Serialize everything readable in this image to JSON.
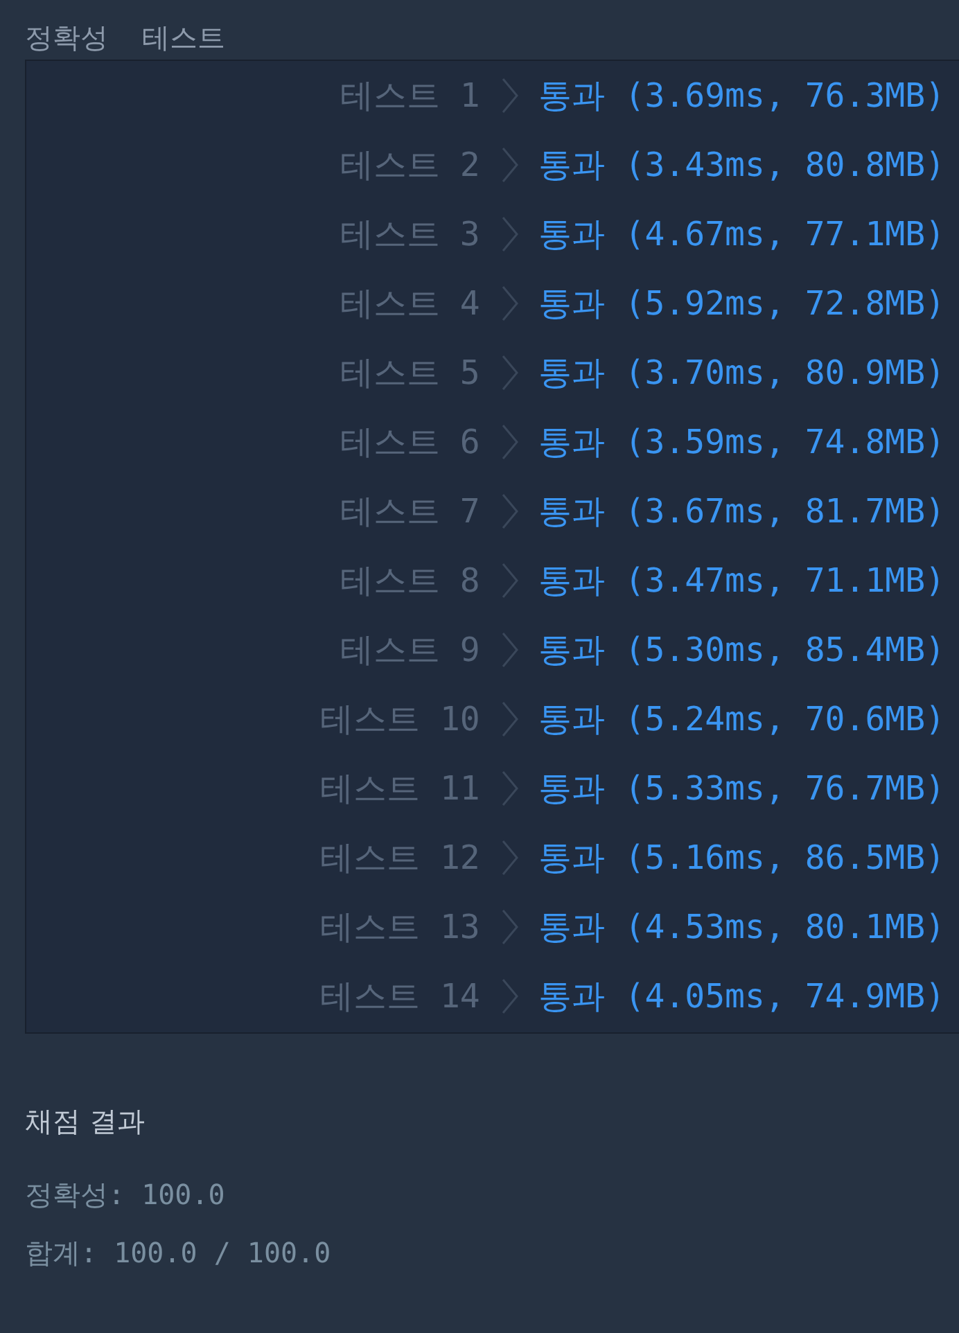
{
  "section_title": "정확성 테스트",
  "tests": [
    {
      "label": "테스트 1",
      "result": "통과 (3.69ms, 76.3MB)"
    },
    {
      "label": "테스트 2",
      "result": "통과 (3.43ms, 80.8MB)"
    },
    {
      "label": "테스트 3",
      "result": "통과 (4.67ms, 77.1MB)"
    },
    {
      "label": "테스트 4",
      "result": "통과 (5.92ms, 72.8MB)"
    },
    {
      "label": "테스트 5",
      "result": "통과 (3.70ms, 80.9MB)"
    },
    {
      "label": "테스트 6",
      "result": "통과 (3.59ms, 74.8MB)"
    },
    {
      "label": "테스트 7",
      "result": "통과 (3.67ms, 81.7MB)"
    },
    {
      "label": "테스트 8",
      "result": "통과 (3.47ms, 71.1MB)"
    },
    {
      "label": "테스트 9",
      "result": "통과 (5.30ms, 85.4MB)"
    },
    {
      "label": "테스트 10",
      "result": "통과 (5.24ms, 70.6MB)"
    },
    {
      "label": "테스트 11",
      "result": "통과 (5.33ms, 76.7MB)"
    },
    {
      "label": "테스트 12",
      "result": "통과 (5.16ms, 86.5MB)"
    },
    {
      "label": "테스트 13",
      "result": "통과 (4.53ms, 80.1MB)"
    },
    {
      "label": "테스트 14",
      "result": "통과 (4.05ms, 74.9MB)"
    }
  ],
  "grading": {
    "title": "채점 결과",
    "lines": [
      "정확성: 100.0",
      "합계: 100.0 / 100.0"
    ]
  }
}
